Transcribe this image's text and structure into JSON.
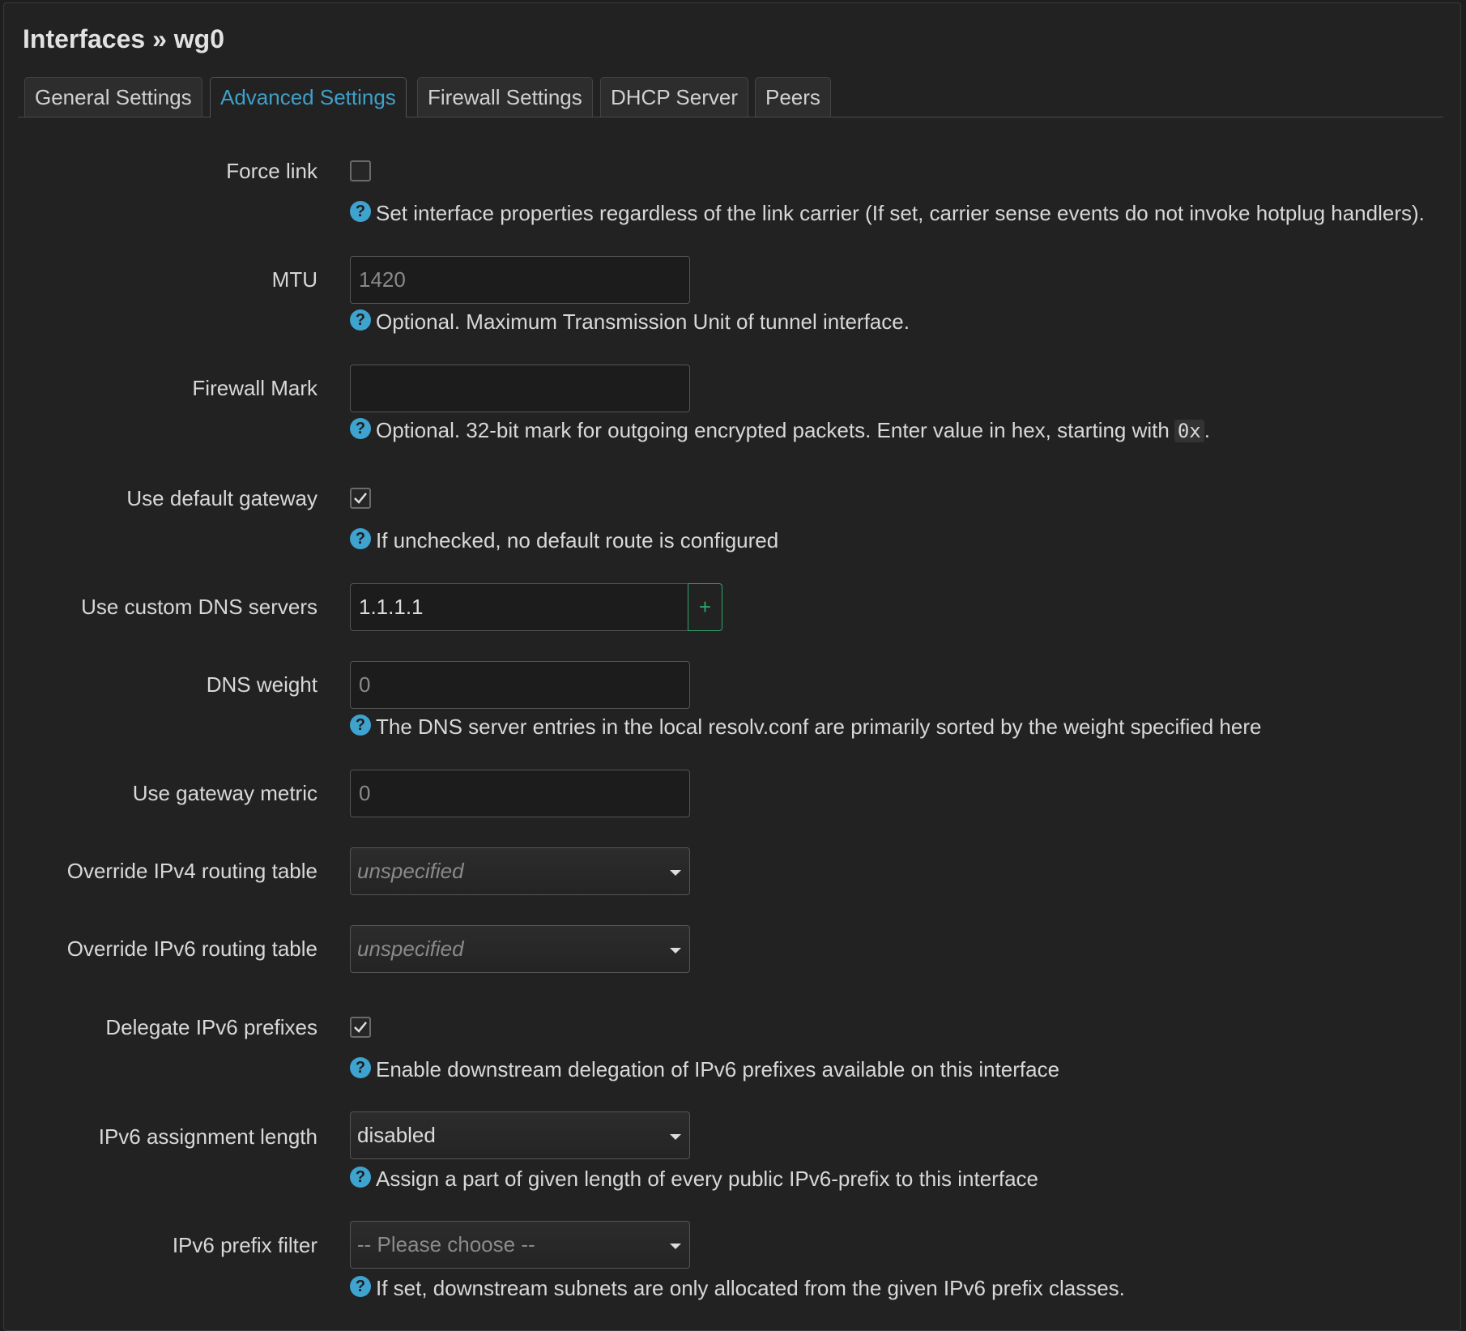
{
  "page_title": "Interfaces » wg0",
  "tabs": [
    {
      "label": "General Settings",
      "active": false
    },
    {
      "label": "Advanced Settings",
      "active": true
    },
    {
      "label": "Firewall Settings",
      "active": false
    },
    {
      "label": "DHCP Server",
      "active": false
    },
    {
      "label": "Peers",
      "active": false
    }
  ],
  "fields": {
    "force_link": {
      "label": "Force link",
      "checked": false,
      "help": "Set interface properties regardless of the link carrier (If set, carrier sense events do not invoke hotplug handlers)."
    },
    "mtu": {
      "label": "MTU",
      "value": "",
      "placeholder": "1420",
      "help": "Optional. Maximum Transmission Unit of tunnel interface."
    },
    "firewall_mark": {
      "label": "Firewall Mark",
      "value": "",
      "placeholder": "",
      "help": "Optional. 32-bit mark for outgoing encrypted packets. Enter value in hex, starting with",
      "help_code": "0x",
      "help_suffix": "."
    },
    "default_gateway": {
      "label": "Use default gateway",
      "checked": true,
      "help": "If unchecked, no default route is configured"
    },
    "custom_dns": {
      "label": "Use custom DNS servers",
      "value": "1.1.1.1",
      "add_label": "+"
    },
    "dns_weight": {
      "label": "DNS weight",
      "placeholder": "0",
      "help": "The DNS server entries in the local resolv.conf are primarily sorted by the weight specified here"
    },
    "gateway_metric": {
      "label": "Use gateway metric",
      "placeholder": "0"
    },
    "ipv4_table": {
      "label": "Override IPv4 routing table",
      "selected": "unspecified"
    },
    "ipv6_table": {
      "label": "Override IPv6 routing table",
      "selected": "unspecified"
    },
    "delegate_ipv6": {
      "label": "Delegate IPv6 prefixes",
      "checked": true,
      "help": "Enable downstream delegation of IPv6 prefixes available on this interface"
    },
    "ipv6_assign_len": {
      "label": "IPv6 assignment length",
      "selected": "disabled",
      "help": "Assign a part of given length of every public IPv6-prefix to this interface"
    },
    "ipv6_prefix_filter": {
      "label": "IPv6 prefix filter",
      "selected": "-- Please choose --",
      "help": "If set, downstream subnets are only allocated from the given IPv6 prefix classes."
    }
  },
  "help_icon_glyph": "?",
  "colors": {
    "accent": "#3fa0c8",
    "help_icon": "#3ea3cf",
    "add_button": "#2ea46a",
    "background": "#222222"
  }
}
